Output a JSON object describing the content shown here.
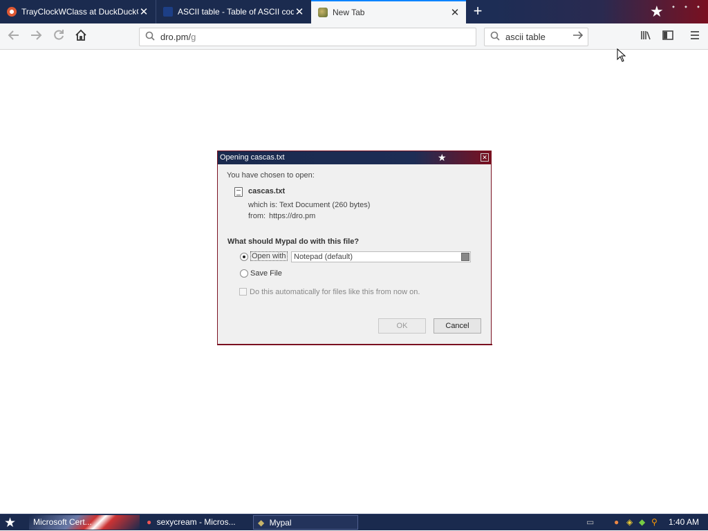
{
  "tabs": [
    {
      "title": "TrayClockWClass at DuckDuckGo",
      "close": "✕"
    },
    {
      "title": "ASCII table - Table of ASCII codes",
      "close": "✕"
    },
    {
      "title": "New Tab",
      "close": "✕"
    }
  ],
  "toolbar": {
    "new_tab": "+",
    "url_text": "dro.pm/",
    "url_rest": "g",
    "search_text": "ascii table"
  },
  "dialog": {
    "title": "Opening cascas.txt",
    "chosen_label": "You have chosen to open:",
    "filename": "cascas.txt",
    "which_is_label": "which is:",
    "which_is_value": "Text Document (260 bytes)",
    "from_label": "from:",
    "from_value": "https://dro.pm",
    "question": "What should Mypal do with this file?",
    "open_with_label": "Open with",
    "open_with_app": "Notepad (default)",
    "save_file_label": "Save File",
    "auto_label": "Do this automatically for files like this from now on.",
    "ok_label": "OK",
    "cancel_label": "Cancel"
  },
  "taskbar": {
    "task1": "Microsoft Cert...",
    "task2": "sexycream - Micros...",
    "task3": "Mypal",
    "clock": "1:40 AM"
  },
  "colors": {
    "accent": "#0a84ff",
    "titlebar_navy": "#1a2a4e",
    "titlebar_red": "#7a1020"
  }
}
